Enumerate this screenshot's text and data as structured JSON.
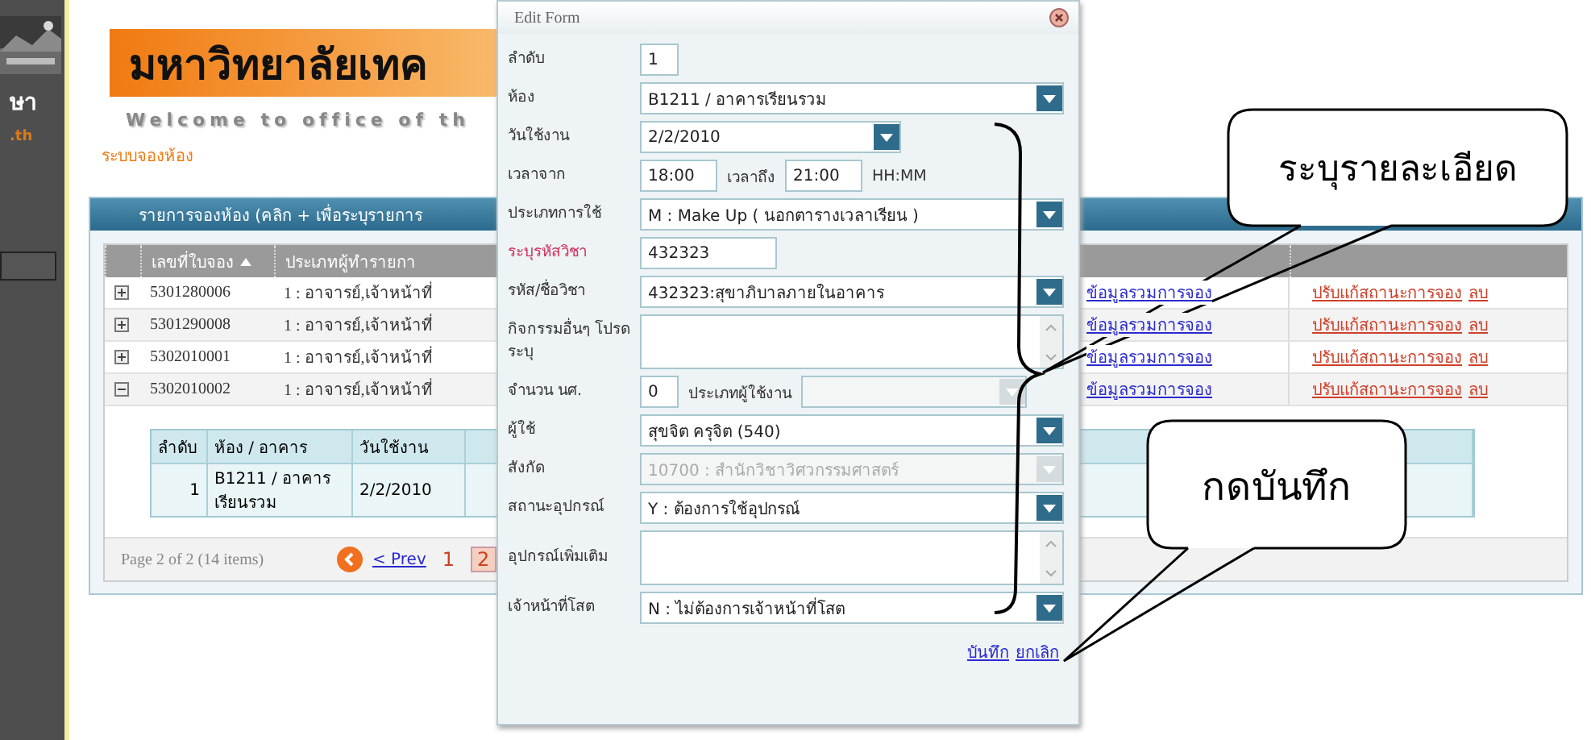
{
  "sidebar": {
    "texts": [
      {
        "text": "ษา",
        "kind": "title"
      },
      {
        "text": ".th",
        "kind": "accent"
      }
    ]
  },
  "banner": {
    "title": "มหาวิทยาลัยเทค",
    "welcome": "Welcome to office of th"
  },
  "breadcrumb": "ระบบจองห้อง",
  "panel": {
    "title": "รายการจองห้อง (คลิก + เพื่อระบุรายการ",
    "columns": [
      {
        "label": "เลขที่ใบจอง",
        "sorted": true
      },
      {
        "label": "ประเภทผู้ทำรายกา",
        "sorted": false
      }
    ],
    "rows": [
      {
        "expanded": false,
        "number": "5301280006",
        "type": "1 : อาจารย์,เจ้าหน้าที่",
        "link_1": "ข้อมูลรวมการจอง",
        "link_2": "ปรับแก้สถานะการจอง",
        "link_3": "ลบ"
      },
      {
        "expanded": false,
        "number": "5301290008",
        "type": "1 : อาจารย์,เจ้าหน้าที่",
        "link_1": "ข้อมูลรวมการจอง",
        "link_2": "ปรับแก้สถานะการจอง",
        "link_3": "ลบ"
      },
      {
        "expanded": false,
        "number": "5302010001",
        "type": "1 : อาจารย์,เจ้าหน้าที่",
        "link_1": "ข้อมูลรวมการจอง",
        "link_2": "ปรับแก้สถานะการจอง",
        "link_3": "ลบ"
      },
      {
        "expanded": true,
        "number": "5302010002",
        "type": "1 : อาจารย์,เจ้าหน้าที่",
        "link_1": "ข้อมูลรวมการจอง",
        "link_2": "ปรับแก้สถานะการจอง",
        "link_3": "ลบ"
      }
    ],
    "detail": {
      "columns": [
        "ลำดับ",
        "ห้อง / อาคาร",
        "วันใช้งาน"
      ],
      "row": [
        "1",
        "B1211 / อาคารเรียนรวม",
        "2/2/2010"
      ]
    },
    "pager": {
      "summary": "Page 2 of 2 (14 items)",
      "prev": "< Prev",
      "pages": [
        {
          "label": "1",
          "selected": false
        },
        {
          "label": "2",
          "selected": true
        }
      ]
    }
  },
  "form": {
    "title": "Edit Form",
    "fields": [
      {
        "kind": "short_input",
        "label": "ลำดับ",
        "value": "1",
        "required": false,
        "disabled": false
      },
      {
        "kind": "select",
        "label": "ห้อง",
        "value": "B1211 / อาคารเรียนรวม",
        "required": false,
        "disabled": false
      },
      {
        "kind": "date",
        "label": "วันใช้งาน",
        "value": "2/2/2010",
        "required": false,
        "disabled": false
      },
      {
        "kind": "time_range",
        "label": "เวลาจาก",
        "value": "18:00",
        "to_label": "เวลาถึง",
        "to_value": "21:00",
        "hint": "HH:MM",
        "required": false,
        "disabled": false
      },
      {
        "kind": "select",
        "label": "ประเภทการใช้",
        "value": "M : Make Up ( นอกตารางเวลาเรียน )",
        "required": false,
        "disabled": false
      },
      {
        "kind": "input",
        "label": "ระบุรหัสวิชา",
        "value": "432323",
        "required": true,
        "disabled": false
      },
      {
        "kind": "select",
        "label": "รหัส/ชื่อวิชา",
        "value": "432323:สุขาภิบาลภายในอาคาร",
        "required": false,
        "disabled": false
      },
      {
        "kind": "textarea",
        "label": "กิจกรรมอื่นๆ โปรดระบุ",
        "required": false,
        "disabled": false
      },
      {
        "kind": "count",
        "label": "จำนวน นศ.",
        "value": "0",
        "second_label": "ประเภทผู้ใช้งาน",
        "required": false,
        "disabled": true
      },
      {
        "kind": "select",
        "label": "ผู้ใช้",
        "value": "สุขจิต ครุจิต (540)",
        "required": false,
        "disabled": false
      },
      {
        "kind": "select",
        "label": "สังกัด",
        "value": "10700 : สำนักวิชาวิศวกรรมศาสตร์",
        "required": false,
        "disabled": true
      },
      {
        "kind": "select",
        "label": "สถานะอุปกรณ์",
        "value": "Y : ต้องการใช้อุปกรณ์",
        "required": false,
        "disabled": false
      },
      {
        "kind": "textarea",
        "label": "อุปกรณ์เพิ่มเติม",
        "required": false,
        "disabled": false
      },
      {
        "kind": "select",
        "label": "เจ้าหน้าที่โสต",
        "value": "N : ไม่ต้องการเจ้าหน้าที่โสต",
        "required": false,
        "disabled": false
      }
    ],
    "actions": [
      "บันทึก",
      "ยกเลิก"
    ]
  },
  "callouts": [
    "ระบุรายละเอียด",
    "กดบันทึก"
  ]
}
